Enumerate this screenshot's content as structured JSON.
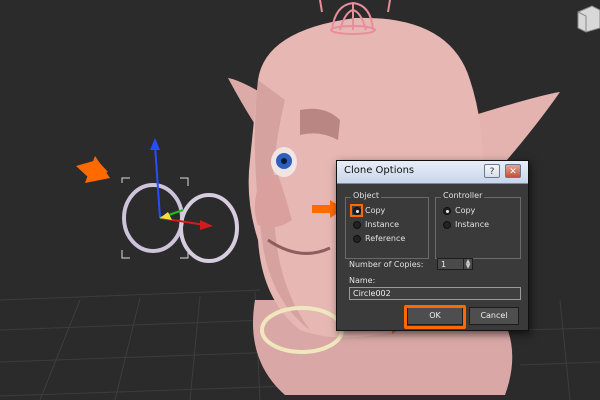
{
  "dialog": {
    "title": "Clone Options",
    "help_symbol": "?",
    "close_symbol": "✕",
    "object_group": {
      "label": "Object",
      "options": [
        "Copy",
        "Instance",
        "Reference"
      ],
      "selected": "Copy"
    },
    "controller_group": {
      "label": "Controller",
      "options": [
        "Copy",
        "Instance"
      ],
      "selected": "Copy"
    },
    "number_of_copies": {
      "label": "Number of Copies:",
      "value": "1"
    },
    "name": {
      "label": "Name:",
      "value": "Circle002"
    },
    "buttons": {
      "ok": "OK",
      "cancel": "Cancel"
    }
  },
  "colors": {
    "highlight": "#ff6a00",
    "viewport_bg": "#2b2b2b",
    "skin": "#e7b7b4"
  },
  "icons": [
    "transform-gizmo-icon",
    "callout-arrow-icon",
    "viewcube-icon"
  ]
}
